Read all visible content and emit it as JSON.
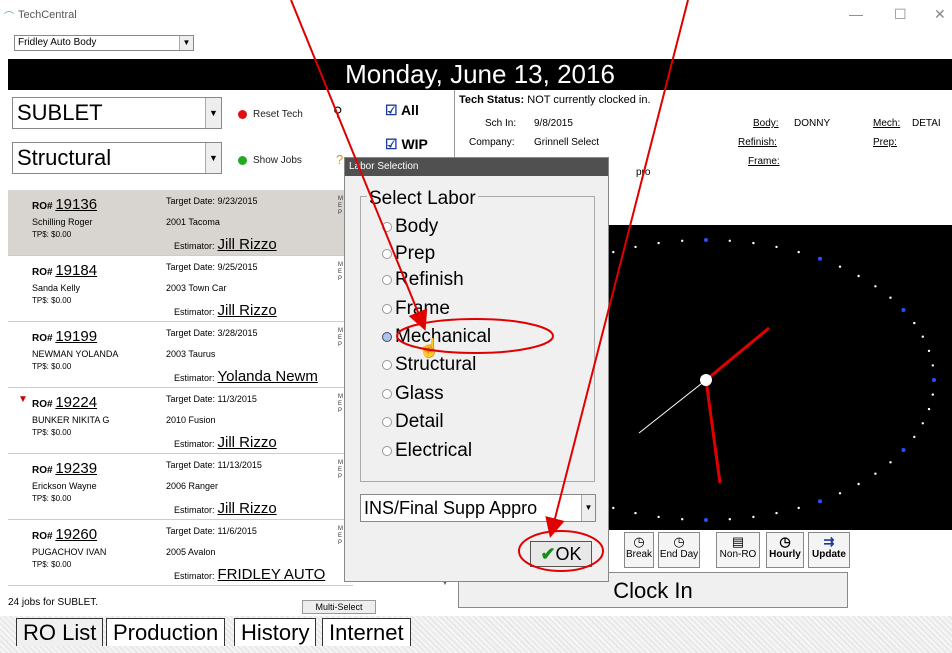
{
  "app": {
    "title": "TechCentral",
    "shop": "Fridley Auto Body"
  },
  "window_controls": {
    "minimize": "—",
    "maximize": "☐",
    "close": "✕"
  },
  "date_header": "Monday, June 13, 2016",
  "left_panel": {
    "category_select": "SUBLET",
    "type_select": "Structural",
    "reset_tech": "Reset Tech",
    "show_jobs": "Show Jobs",
    "all_label": "All",
    "wip_label": "WIP"
  },
  "ro_list": [
    {
      "ro_label": "RO#",
      "ro": "19136",
      "name": "Schilling Roger",
      "tp": "TP$: $0.00",
      "target": "Target Date: 9/23/2015",
      "car": "2001  Tacoma",
      "est_label": "Estimator:",
      "estimator": "Jill Rizzo",
      "flag": false
    },
    {
      "ro_label": "RO#",
      "ro": "19184",
      "name": "Sanda Kelly",
      "tp": "TP$: $0.00",
      "target": "Target Date: 9/25/2015",
      "car": "2003  Town Car",
      "est_label": "Estimator:",
      "estimator": "Jill Rizzo",
      "flag": false
    },
    {
      "ro_label": "RO#",
      "ro": "19199",
      "name": "NEWMAN YOLANDA",
      "tp": "TP$: $0.00",
      "target": "Target Date: 3/28/2015",
      "car": "2003  Taurus",
      "est_label": "Estimator:",
      "estimator": "Yolanda Newm",
      "flag": false
    },
    {
      "ro_label": "RO#",
      "ro": "19224",
      "name": "BUNKER NIKITA G",
      "tp": "TP$: $0.00",
      "target": "Target Date: 11/3/2015",
      "car": "2010  Fusion",
      "est_label": "Estimator:",
      "estimator": "Jill Rizzo",
      "flag": true
    },
    {
      "ro_label": "RO#",
      "ro": "19239",
      "name": "Erickson Wayne",
      "tp": "TP$: $0.00",
      "target": "Target Date: 11/13/2015",
      "car": "2006  Ranger",
      "est_label": "Estimator:",
      "estimator": "Jill Rizzo",
      "flag": false
    },
    {
      "ro_label": "RO#",
      "ro": "19260",
      "name": "PUGACHOV IVAN",
      "tp": "TP$: $0.00",
      "target": "Target Date: 11/6/2015",
      "car": "2005  Avalon",
      "est_label": "Estimator:",
      "estimator": "FRIDLEY AUTO",
      "flag": false
    }
  ],
  "mbar_text": "M\nE\nP",
  "footer": {
    "count": "24 jobs for SUBLET.",
    "multi_select": "Multi-Select"
  },
  "tabs": [
    "RO List",
    "Production",
    "History",
    "Internet"
  ],
  "tech_status": {
    "label": "Tech Status:",
    "value": "NOT currently clocked in.",
    "sch_in_label": "Sch In:",
    "sch_in": "9/8/2015",
    "company_label": "Company:",
    "company": "Grinnell Select",
    "extra": "pro",
    "body_label": "Body:",
    "body": "DONNY",
    "mech_label": "Mech:",
    "mech": "DETAI",
    "refinish_label": "Refinish:",
    "prep_label": "Prep:",
    "frame_label": "Frame:"
  },
  "toolbar": [
    {
      "label": "Break",
      "icon": "clock-icon"
    },
    {
      "label": "End Day",
      "icon": "clock-icon"
    },
    {
      "label": "Non-RO",
      "icon": "note-icon"
    },
    {
      "label": "Hourly",
      "icon": "clock-icon"
    },
    {
      "label": "Update",
      "icon": "arrow-icon"
    }
  ],
  "clock_in": "Clock In",
  "dialog": {
    "title": "Labor Selection",
    "legend": "Select Labor",
    "options": [
      "Body",
      "Prep",
      "Refinish",
      "Frame",
      "Mechanical",
      "Structural",
      "Glass",
      "Detail",
      "Electrical"
    ],
    "selected": "Mechanical",
    "supplement_select": "INS/Final Supp Appro",
    "ok": "OK"
  },
  "colors": {
    "annotation": "#e00000",
    "clock_dots": "#ffffff",
    "clock_accent": "#2a4dff"
  }
}
